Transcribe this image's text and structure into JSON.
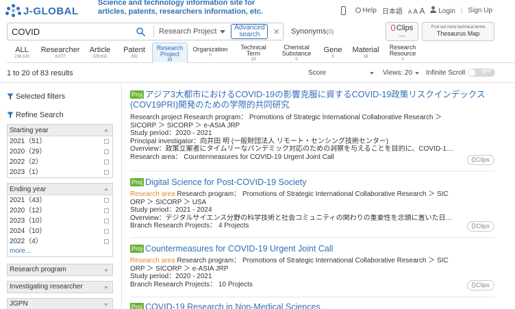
{
  "header": {
    "logo_text": "J-GLOBAL",
    "tagline": "Science and technology information site for articles, patents, researchers information, etc.",
    "help": "Help",
    "language": "日本語",
    "font_small": "A",
    "font_mid": "A",
    "font_large": "A",
    "login": "Login",
    "signup": "Sign Up"
  },
  "search": {
    "value": "COVID",
    "type": "Research Project",
    "advanced_line1": "Advanced",
    "advanced_line2": "search",
    "clear": "×",
    "synonyms_label": "Synonyms",
    "synonyms_count": "(0)",
    "clips_label": "Clips",
    "clips_sub": "—",
    "thesaurus_small": "Find out more technical terms",
    "thesaurus_big": "Thesaurus Map"
  },
  "tabs": [
    {
      "label": "ALL",
      "count": "238,103"
    },
    {
      "label": "Researcher",
      "count": "8,077"
    },
    {
      "label": "Article",
      "count": "229,611"
    },
    {
      "label": "Patent",
      "count": "292"
    },
    {
      "label1": "Research",
      "label2": "Project",
      "count": "83"
    },
    {
      "label": "Organization",
      "count": "0"
    },
    {
      "label1": "Technical",
      "label2": "Term",
      "count": "24"
    },
    {
      "label1": "Chemical",
      "label2": "Substance",
      "count": "0"
    },
    {
      "label": "Gene",
      "count": "0"
    },
    {
      "label": "Material",
      "count": "16"
    },
    {
      "label1": "Research",
      "label2": "Resource",
      "count": "0"
    }
  ],
  "toolbar": {
    "results_count": "1 to 20 of 83 results",
    "sort": "Score",
    "views": "Views: 20",
    "infinite_scroll": "Infinite Scroll",
    "toggle_state": "OFF"
  },
  "sidebar": {
    "selected_filters": "Selected filters",
    "refine_search": "Refine Search",
    "starting_year": {
      "title": "Starting year",
      "items": [
        "2021（51）",
        "2020（29）",
        "2022（2）",
        "2023（1）"
      ]
    },
    "ending_year": {
      "title": "Ending year",
      "items": [
        "2021（43）",
        "2020（12）",
        "2023（10）",
        "2024（10）",
        "2022（4）"
      ],
      "more": "more..."
    },
    "collapsed": [
      "Research program",
      "Investigating researcher",
      "JGPN"
    ]
  },
  "results": [
    {
      "badge": "Proj",
      "title": "アジア3大都市におけるCOVID-19の影響克服に資するCOVID-19政策リスクインデックス(COV19PRI)開発のための学際的共同研究",
      "line1": "Research project   Research program： Promotions of Strategic International Collaborative Research ＞",
      "line2": "SICORP ＞ SICORP ＞ e-ASIA JRP",
      "line3": "Study period：2020 - 2021",
      "line4": "Principal investigator：向井田 明 (一般財団法人 リモート・センシング技術センター)",
      "line5": "Overview：政策立案者にタイムリーなパンデミック対応のための洞察を与えることを目的に、COVID-19の感染拡大...",
      "line6": "Research area： Countermeasures for COVID-19 Urgent Joint Call",
      "clips": "Clips"
    },
    {
      "badge": "Proj",
      "title": "Digital Science for Post-COVID-19 Society",
      "tag": "Research area",
      "line1": "   Research program： Promotions of Strategic International Collaborative Research ＞ SIC",
      "line2": "ORP ＞ SICORP ＞ USA",
      "line3": "Study period：2021 - 2024",
      "line4": "Overview：デジタルサイエンス分野の科学技術と社会コミュニティの関わりの重要性を念頭に置いた日米の共同研究...",
      "line5": "Branch Research Projects： 4 Projects",
      "clips": "Clips"
    },
    {
      "badge": "Proj",
      "title": "Countermeasures for COVID-19 Urgent Joint Call",
      "tag": "Research area",
      "line1": "   Research program： Promotions of Strategic International Collaborative Research ＞ SIC",
      "line2": "ORP ＞ SICORP ＞ e-ASIA JRP",
      "line3": "Study period：2020 - 2021",
      "line4": "Branch Research Projects： 10 Projects",
      "clips": "Clips"
    },
    {
      "badge": "Proj",
      "title": "COVID-19 Research in Non-Medical Sciences"
    }
  ]
}
